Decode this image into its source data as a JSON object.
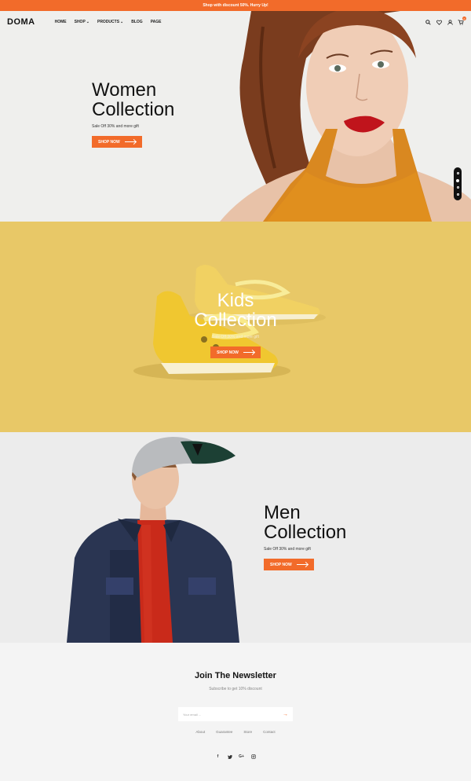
{
  "promo": {
    "text": "Shop with discount 50%. Hurry Up!"
  },
  "header": {
    "logo": "DOMA",
    "nav": [
      {
        "label": "HOME",
        "dropdown": false
      },
      {
        "label": "SHOP",
        "dropdown": true
      },
      {
        "label": "PRODUCTS",
        "dropdown": true
      },
      {
        "label": "BLOG",
        "dropdown": false
      },
      {
        "label": "PAGE",
        "dropdown": false
      }
    ],
    "icons": [
      "search-icon",
      "heart-icon",
      "user-icon",
      "cart-icon"
    ],
    "cart_count": "0"
  },
  "hero": {
    "women": {
      "title_line1": "Women",
      "title_line2": "Collection",
      "subtitle": "Sale Off 30% and more gift",
      "button": "SHOP NOW"
    },
    "kids": {
      "title_line1": "Kids",
      "title_line2": "Collection",
      "subtitle": "Sale Off 30% and more gift",
      "button": "SHOP NOW"
    },
    "men": {
      "title_line1": "Men",
      "title_line2": "Collection",
      "subtitle": "Sale Off 30% and more gift",
      "button": "SHOP NOW"
    },
    "slider_dots": 4,
    "active_dot": 2
  },
  "newsletter": {
    "title": "Join The Newsletter",
    "subtitle": "Subscribe to get 10% discount",
    "placeholder": "Your email ...",
    "links": [
      "About",
      "Guarantee",
      "Store",
      "Contact"
    ],
    "socials": [
      "facebook-icon",
      "twitter-icon",
      "google-plus-icon",
      "instagram-icon"
    ]
  },
  "colors": {
    "accent": "#f26b2a",
    "kids_bg": "#e8c867",
    "women_bg": "#efefed",
    "men_bg": "#ececec"
  }
}
